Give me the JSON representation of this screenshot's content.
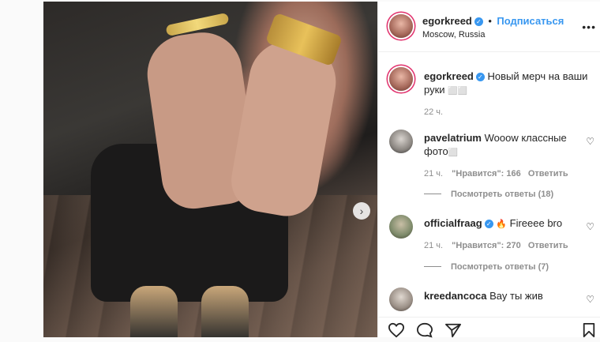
{
  "post": {
    "username": "egorkreed",
    "follow_label": "Подписаться",
    "location": "Moscow, Russia",
    "more_label": "•••"
  },
  "caption": {
    "username": "egorkreed",
    "text": "Новый мерч на ваши руки",
    "emoji": "⬜⬜",
    "time": "22 ч."
  },
  "comments": [
    {
      "username": "pavelatrium",
      "text": "Wooow классные фото",
      "emoji": "⬜",
      "time": "21 ч.",
      "likes": "\"Нравится\": 166",
      "reply": "Ответить",
      "view_replies": "Посмотреть ответы (18)"
    },
    {
      "username": "officialfraag",
      "text": "Fireeee bro",
      "time": "21 ч.",
      "likes": "\"Нравится\": 270",
      "reply": "Ответить",
      "view_replies": "Посмотреть ответы (7)"
    },
    {
      "username": "kreedancoca",
      "text": "Вау ты жив"
    }
  ],
  "icons": {
    "like": "heart-icon",
    "comment": "comment-icon",
    "share": "share-icon",
    "save": "bookmark-icon",
    "next": "chevron-right-icon"
  },
  "colors": {
    "accent": "#3897f0",
    "story_ring": "#e1306c",
    "text": "#262626",
    "muted": "#8e8e8e"
  }
}
